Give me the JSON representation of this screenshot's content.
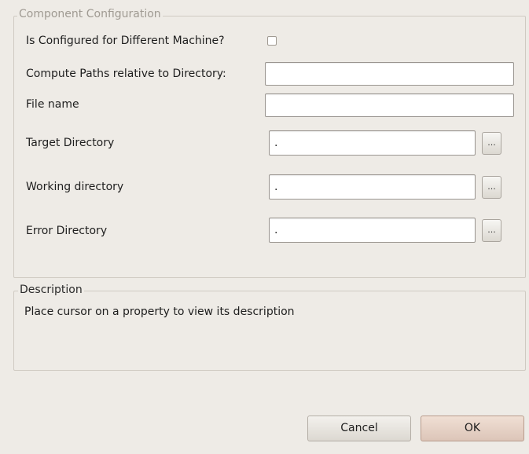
{
  "config": {
    "legend": "Component Configuration",
    "checkbox_label": "Is Configured for Different Machine?",
    "compute_paths_label": "Compute Paths relative to Directory:",
    "compute_paths_value": "",
    "file_name_label": "File name",
    "file_name_value": "",
    "target_dir_label": "Target Directory",
    "target_dir_value": ".",
    "working_dir_label": "Working directory",
    "working_dir_value": ".",
    "error_dir_label": "Error Directory",
    "error_dir_value": ".",
    "browse_label": "..."
  },
  "description": {
    "legend": "Description",
    "text": "Place cursor on a property to view its description"
  },
  "buttons": {
    "cancel": "Cancel",
    "ok": "OK"
  }
}
